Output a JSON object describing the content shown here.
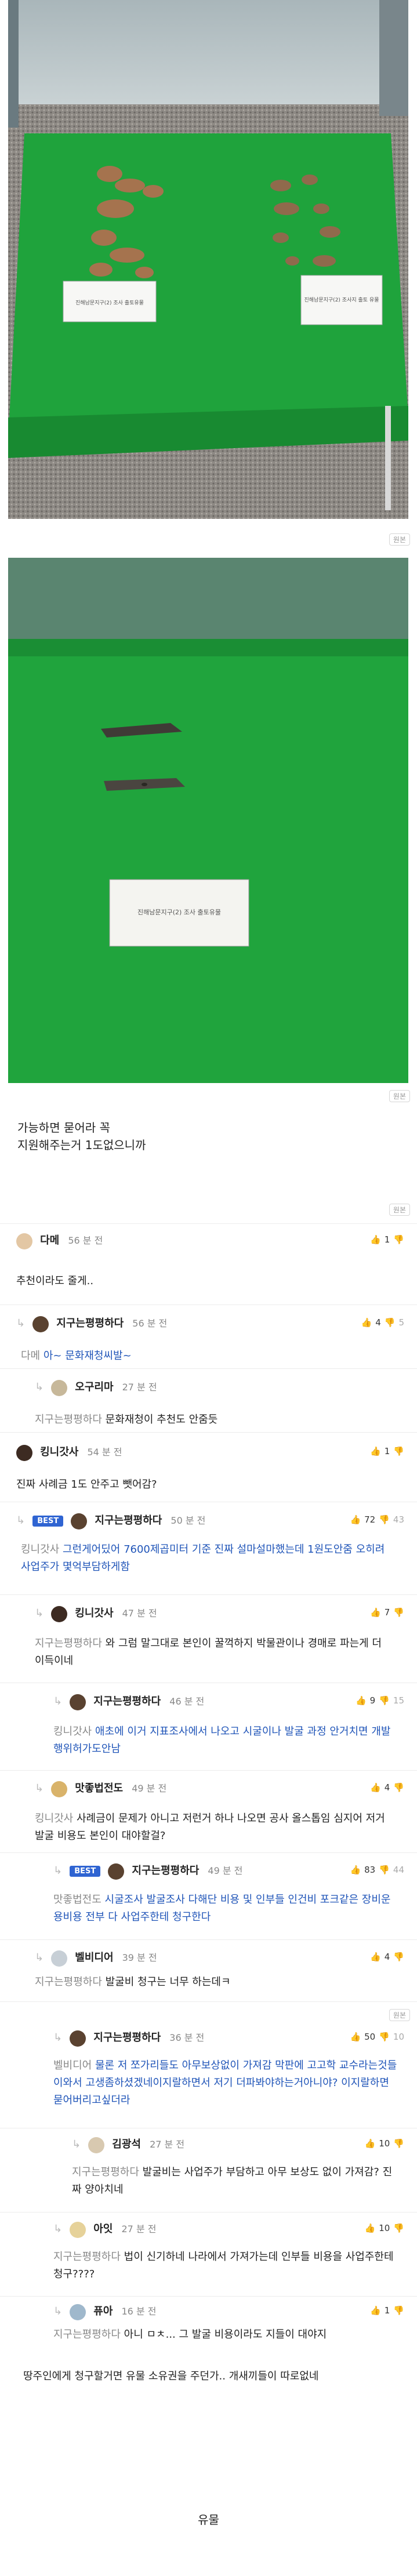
{
  "post": {
    "source_label": "원본",
    "text_line1": "가능하면 묻어라 꼭",
    "text_line2": "지원해주는거 1도없으니까",
    "sign1": "진해남문지구(2) 조사 출토유물",
    "sign2": "진해남문지구(2) 조사지 출토 유물",
    "sign3": "진해남문지구(2) 조사 출토유물"
  },
  "comments": [
    {
      "nick": "다메",
      "time": "56 분 전",
      "text": "추천이라도 줄게..",
      "up": "1",
      "down": ""
    },
    {
      "nick": "지구는평평하다",
      "time": "56 분 전",
      "quote": "다메",
      "text": "아~ 문화재청씨발~",
      "up": "4",
      "down": "5"
    },
    {
      "nick": "오구리마",
      "time": "27 분 전",
      "quote": "지구는평평하다",
      "text": "문화재청이 추천도 안줌듯",
      "up": "",
      "down": ""
    },
    {
      "nick": "킹니갓사",
      "time": "54 분 전",
      "text": "진짜 사례금 1도 안주고 뺏어감?",
      "up": "1",
      "down": ""
    },
    {
      "badge": "BEST",
      "nick": "지구는평평하다",
      "time": "50 분 전",
      "quote": "킹니갓사",
      "text": "그런게어딨어 7600제곱미터 기준 진짜 설마설마했는데 1원도안줌 오히려 사업주가 몇억부담하게함",
      "up": "72",
      "down": "43"
    },
    {
      "nick": "킹니갓사",
      "time": "47 분 전",
      "quote": "지구는평평하다",
      "text": "와 그럼 말그대로 본인이 꿀꺽하지 박물관이나 경매로 파는게 더 이득이네",
      "up": "7",
      "down": ""
    },
    {
      "nick": "지구는평평하다",
      "time": "46 분 전",
      "quote": "킹니갓사",
      "text": "애초에 이거 지표조사에서 나오고 시굴이나 발굴 과정 안거치면 개발행위허가도안남",
      "up": "9",
      "down": "15"
    },
    {
      "nick": "맛좋법전도",
      "time": "49 분 전",
      "quote": "킹니갓사",
      "text": "사례금이 문제가 아니고 저런거 하나 나오면 공사 올스톱임 심지어 저거 발굴 비용도 본인이 대야할걸?",
      "up": "4",
      "down": ""
    },
    {
      "badge": "BEST",
      "nick": "지구는평평하다",
      "time": "49 분 전",
      "quote": "맛좋법전도",
      "text": "시굴조사 발굴조사 다해단 비용 및 인부들 인건비 포크같은 장비운용비용 전부 다 사업주한테 청구한다",
      "up": "83",
      "down": "44"
    },
    {
      "nick": "벨비디어",
      "time": "39 분 전",
      "quote": "지구는평평하다",
      "text": "발굴비 청구는 너무 하는데ㅋ",
      "up": "4",
      "down": ""
    },
    {
      "nick": "지구는평평하다",
      "time": "36 분 전",
      "quote": "벨비디어",
      "text": "물론 저 쪼가리들도 아무보상없이 가져감 막판에 고고학 교수라는것들이와서 고생좀하셨겠네이지랄하면서 저기 더파봐야하는거아니야? 이지랄하면 묻어버리고싶더라",
      "up": "50",
      "down": "10"
    },
    {
      "nick": "김광석",
      "time": "27 분 전",
      "quote": "지구는평평하다",
      "text": "발굴비는 사업주가 부담하고 아무 보상도 없이 가져감? 진짜 양아치네",
      "up": "10",
      "down": ""
    },
    {
      "nick": "아잇",
      "time": "27 분 전",
      "quote": "지구는평평하다",
      "text": "법이 신기하네 나라에서 가져가는데 인부들 비용을 사업주한테 청구????",
      "up": "10",
      "down": ""
    },
    {
      "nick": "퓨아",
      "time": "16 분 전",
      "quote": "지구는평평하다",
      "text": "아니 ㅁㅊ... 그 발굴 비용이라도 지들이 대야지",
      "up": "1",
      "down": ""
    }
  ],
  "tail_text": "땅주인에게 청구할거면 유물 소유권을 주던가.. 개새끼들이 따로없네",
  "footer": {
    "title": "유물"
  }
}
